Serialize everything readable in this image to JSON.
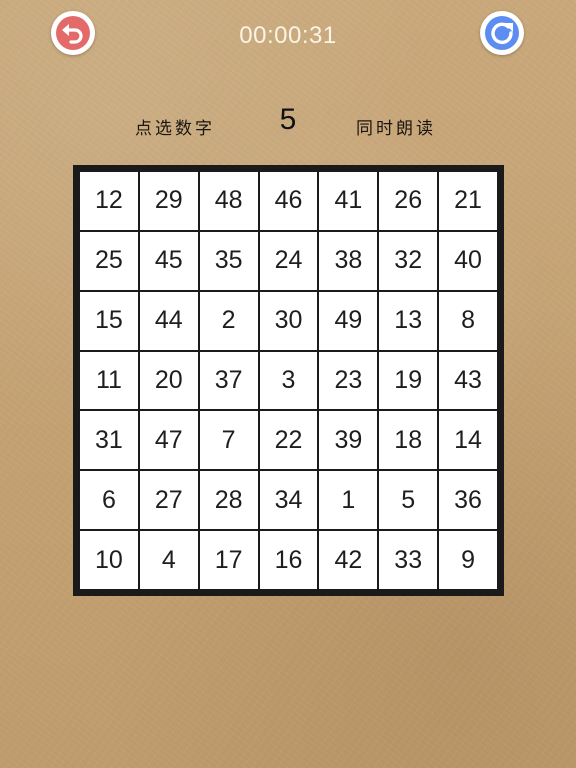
{
  "header": {
    "timer": "00:00:31",
    "back_button_color": "#e46a6a",
    "reset_button_color": "#5d8df0",
    "back_icon": "undo-arrow-icon",
    "reset_icon": "refresh-icon"
  },
  "instruction": {
    "left_text": "点选数字",
    "target_number": "5",
    "right_text": "同时朗读"
  },
  "grid": {
    "rows": 7,
    "cols": 7,
    "cells": [
      "12",
      "29",
      "48",
      "46",
      "41",
      "26",
      "21",
      "25",
      "45",
      "35",
      "24",
      "38",
      "32",
      "40",
      "15",
      "44",
      "2",
      "30",
      "49",
      "13",
      "8",
      "11",
      "20",
      "37",
      "3",
      "23",
      "19",
      "43",
      "31",
      "47",
      "7",
      "22",
      "39",
      "18",
      "14",
      "6",
      "27",
      "28",
      "34",
      "1",
      "5",
      "36",
      "10",
      "4",
      "17",
      "16",
      "42",
      "33",
      "9"
    ]
  }
}
